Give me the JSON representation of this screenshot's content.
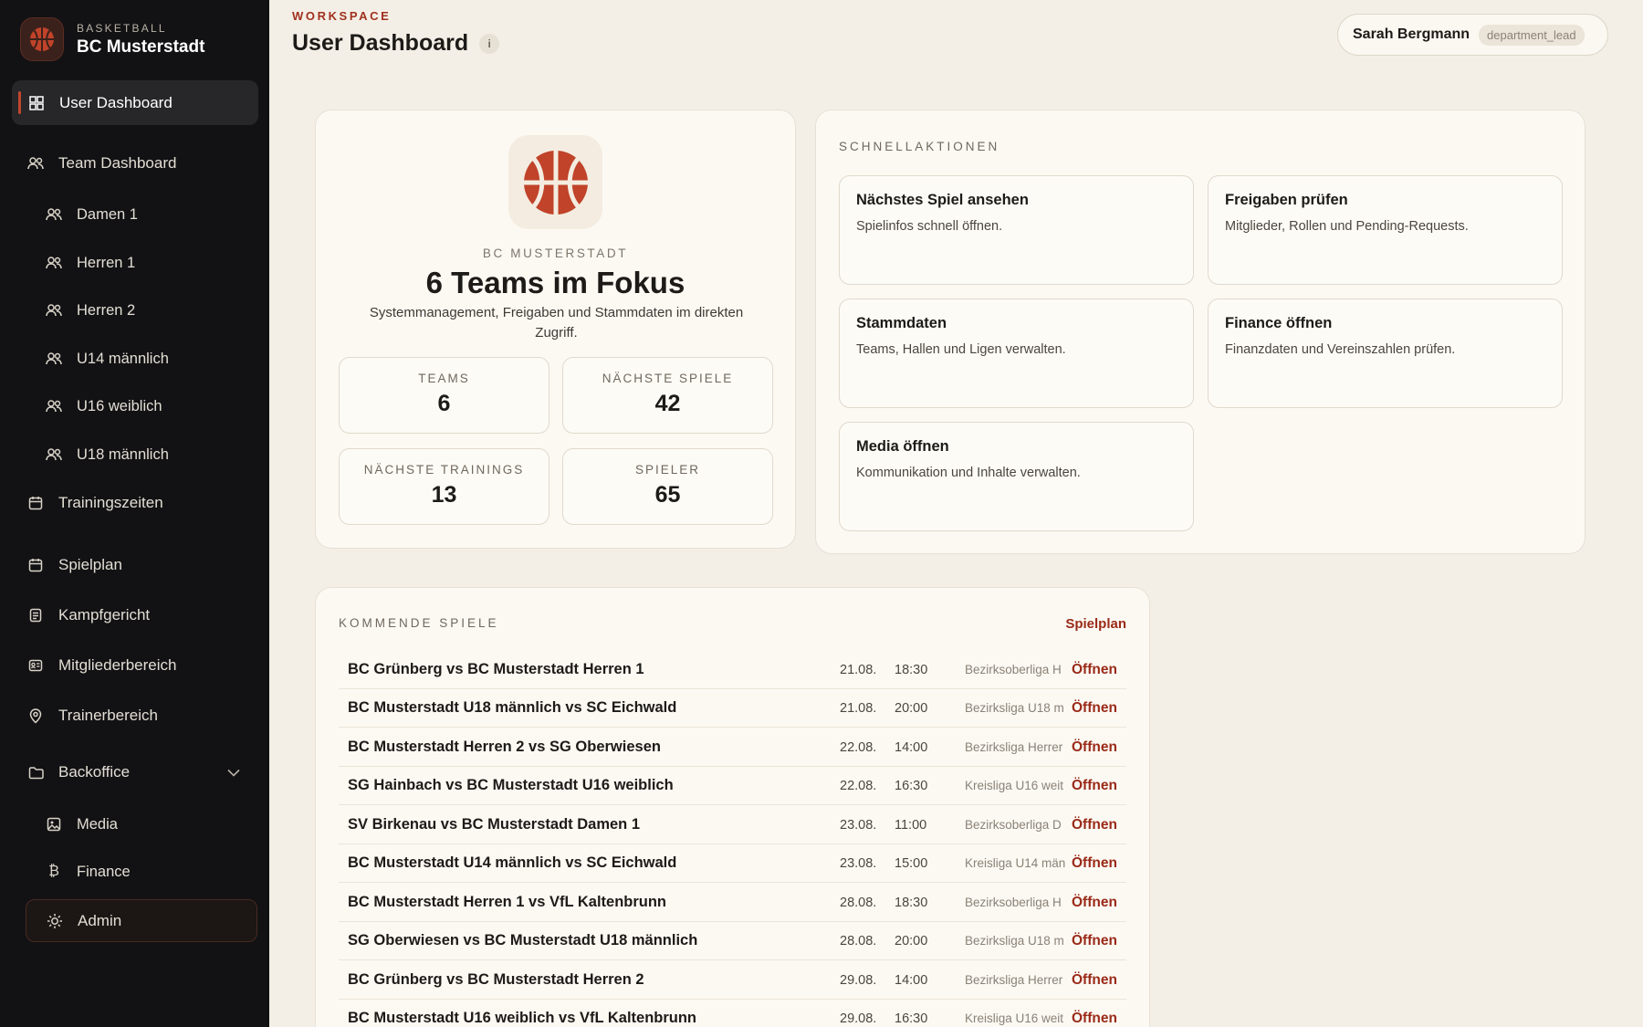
{
  "brand": {
    "eyebrow": "BASKETBALL",
    "name": "BC Musterstadt"
  },
  "nav": {
    "user_dashboard": "User Dashboard",
    "team_dashboard": "Team Dashboard",
    "teams": [
      "Damen 1",
      "Herren 1",
      "Herren 2",
      "U14 männlich",
      "U16 weiblich",
      "U18 männlich"
    ],
    "trainingszeiten": "Trainingszeiten",
    "spielplan": "Spielplan",
    "kampfgericht": "Kampfgericht",
    "mitgliederbereich": "Mitgliederbereich",
    "trainerbereich": "Trainerbereich",
    "backoffice": "Backoffice",
    "media": "Media",
    "finance": "Finance",
    "admin": "Admin"
  },
  "header": {
    "eyebrow": "WORKSPACE",
    "title": "User Dashboard",
    "info": "i"
  },
  "user": {
    "name": "Sarah Bergmann",
    "role": "department_lead"
  },
  "hero": {
    "eyebrow": "BC MUSTERSTADT",
    "title": "6 Teams im Fokus",
    "description": "Systemmanagement, Freigaben und Stammdaten im direkten Zugriff.",
    "stats": [
      {
        "label": "TEAMS",
        "value": "6"
      },
      {
        "label": "NÄCHSTE SPIELE",
        "value": "42"
      },
      {
        "label": "NÄCHSTE TRAININGS",
        "value": "13"
      },
      {
        "label": "SPIELER",
        "value": "65"
      }
    ]
  },
  "quick": {
    "label": "SCHNELLAKTIONEN",
    "actions": [
      {
        "title": "Nächstes Spiel ansehen",
        "desc": "Spielinfos schnell öffnen."
      },
      {
        "title": "Freigaben prüfen",
        "desc": "Mitglieder, Rollen und Pending-Requests."
      },
      {
        "title": "Stammdaten",
        "desc": "Teams, Hallen und Ligen verwalten."
      },
      {
        "title": "Finance öffnen",
        "desc": "Finanzdaten und Vereinszahlen prüfen."
      },
      {
        "title": "Media öffnen",
        "desc": "Kommunikation und Inhalte verwalten."
      }
    ]
  },
  "games": {
    "label": "KOMMENDE SPIELE",
    "link": "Spielplan",
    "open_label": "Öffnen",
    "rows": [
      {
        "match": "BC Grünberg vs BC Musterstadt Herren 1",
        "date": "21.08.",
        "time": "18:30",
        "league": "Bezirksoberliga H"
      },
      {
        "match": "BC Musterstadt U18 männlich vs SC Eichwald",
        "date": "21.08.",
        "time": "20:00",
        "league": "Bezirksliga U18 m"
      },
      {
        "match": "BC Musterstadt Herren 2 vs SG Oberwiesen",
        "date": "22.08.",
        "time": "14:00",
        "league": "Bezirksliga Herrer"
      },
      {
        "match": "SG Hainbach vs BC Musterstadt U16 weiblich",
        "date": "22.08.",
        "time": "16:30",
        "league": "Kreisliga U16 weit"
      },
      {
        "match": "SV Birkenau vs BC Musterstadt Damen 1",
        "date": "23.08.",
        "time": "11:00",
        "league": "Bezirksoberliga D"
      },
      {
        "match": "BC Musterstadt U14 männlich vs SC Eichwald",
        "date": "23.08.",
        "time": "15:00",
        "league": "Kreisliga U14 män"
      },
      {
        "match": "BC Musterstadt Herren 1 vs VfL Kaltenbrunn",
        "date": "28.08.",
        "time": "18:30",
        "league": "Bezirksoberliga H"
      },
      {
        "match": "SG Oberwiesen vs BC Musterstadt U18 männlich",
        "date": "28.08.",
        "time": "20:00",
        "league": "Bezirksliga U18 m"
      },
      {
        "match": "BC Grünberg vs BC Musterstadt Herren 2",
        "date": "29.08.",
        "time": "14:00",
        "league": "Bezirksliga Herrer"
      },
      {
        "match": "BC Musterstadt U16 weiblich vs VfL Kaltenbrunn",
        "date": "29.08.",
        "time": "16:30",
        "league": "Kreisliga U16 weit"
      }
    ]
  },
  "colors": {
    "accent": "#9a2a18",
    "sidebar": "#121214",
    "background": "#f4efe6"
  }
}
